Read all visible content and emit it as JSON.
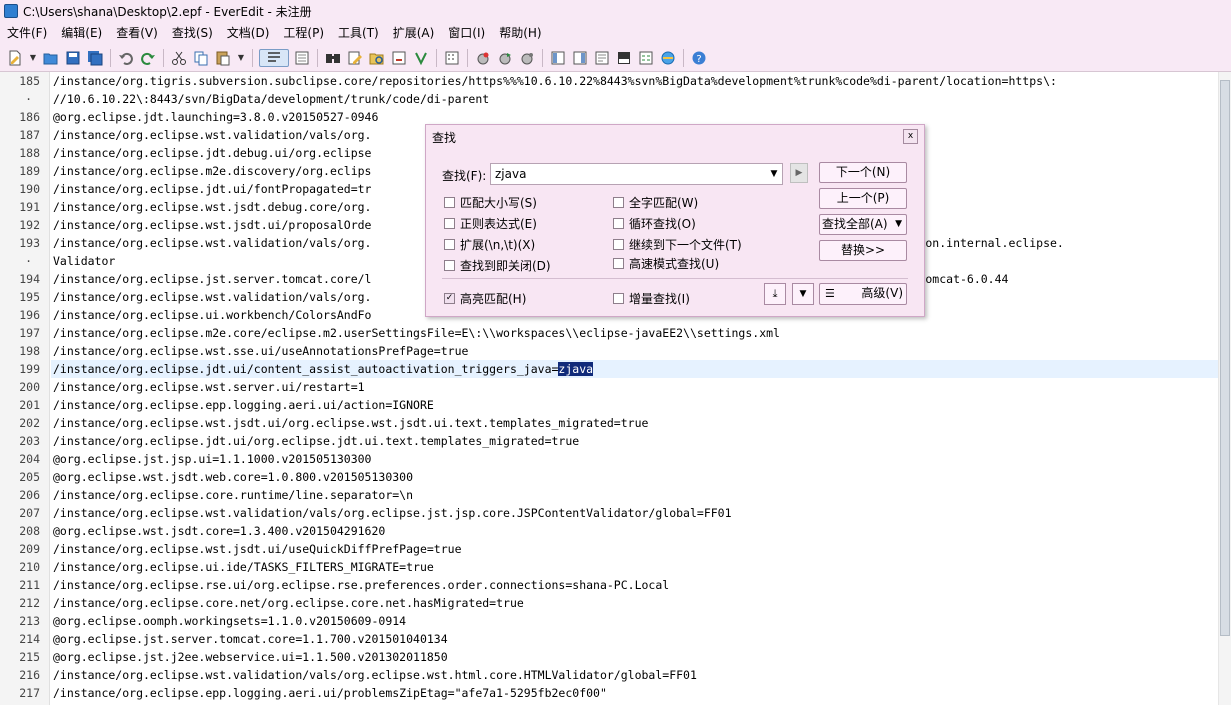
{
  "window": {
    "title": "C:\\Users\\shana\\Desktop\\2.epf - EverEdit - 未注册"
  },
  "menu": [
    "文件(F)",
    "编辑(E)",
    "查看(V)",
    "查找(S)",
    "文档(D)",
    "工程(P)",
    "工具(T)",
    "扩展(A)",
    "窗口(I)",
    "帮助(H)"
  ],
  "toolbar_icons": [
    "new-file-icon",
    "open-folder-icon",
    "save-icon",
    "save-all-icon",
    "undo-icon",
    "redo-icon",
    "cut-icon",
    "copy-icon",
    "paste-icon",
    "word-wrap-icon",
    "column-mode-icon",
    "find-icon",
    "replace-icon",
    "find-in-files-icon",
    "regex-icon",
    "mark-icon",
    "hex-icon",
    "macro-record-icon",
    "macro-play-icon",
    "macro-icon",
    "file-tree-icon",
    "outline-icon",
    "clipboard-icon",
    "output-icon",
    "preview-icon",
    "browser-icon",
    "help-icon"
  ],
  "editor": {
    "lines": [
      {
        "n": "185",
        "text": "/instance/org.tigris.subversion.subclipse.core/repositories/https%%%10.6.10.22%8443%svn%BigData%development%trunk%code%di-parent/location=https\\:"
      },
      {
        "n": "·",
        "text": "//10.6.10.22\\:8443/svn/BigData/development/trunk/code/di-parent"
      },
      {
        "n": "186",
        "text": "@org.eclipse.jdt.launching=3.8.0.v20150527-0946"
      },
      {
        "n": "187",
        "text": "/instance/org.eclipse.wst.validation/vals/org."
      },
      {
        "n": "188",
        "text": "/instance/org.eclipse.jdt.debug.ui/org.eclipse                                                                  es=true"
      },
      {
        "n": "189",
        "text": "/instance/org.eclipse.m2e.discovery/org.eclips"
      },
      {
        "n": "190",
        "text": "/instance/org.eclipse.jdt.ui/fontPropagated=tr"
      },
      {
        "n": "191",
        "text": "/instance/org.eclipse.wst.jsdt.debug.core/org."
      },
      {
        "n": "192",
        "text": "/instance/org.eclipse.wst.jsdt.ui/proposalOrde"
      },
      {
        "n": "193",
        "text": "/instance/org.eclipse.wst.validation/vals/org.                                                                   wsdl.validation.internal.eclipse."
      },
      {
        "n": "·",
        "text": "Validator"
      },
      {
        "n": "194",
        "text": "/instance/org.eclipse.jst.server.tomcat.core/l                                                                   m/GreenSoft/tomcat-6.0.44"
      },
      {
        "n": "195",
        "text": "/instance/org.eclipse.wst.validation/vals/org."
      },
      {
        "n": "196",
        "text": "/instance/org.eclipse.ui.workbench/ColorsAndFo"
      },
      {
        "n": "197",
        "text": "/instance/org.eclipse.m2e.core/eclipse.m2.userSettingsFile=E\\:\\\\workspaces\\\\eclipse-javaEE2\\\\settings.xml"
      },
      {
        "n": "198",
        "text": "/instance/org.eclipse.wst.sse.ui/useAnnotationsPrefPage=true"
      },
      {
        "n": "199",
        "text": "/instance/org.eclipse.jdt.ui/content_assist_autoactivation_triggers_java=",
        "sel": "zjava"
      },
      {
        "n": "200",
        "text": "/instance/org.eclipse.wst.server.ui/restart=1"
      },
      {
        "n": "201",
        "text": "/instance/org.eclipse.epp.logging.aeri.ui/action=IGNORE"
      },
      {
        "n": "202",
        "text": "/instance/org.eclipse.wst.jsdt.ui/org.eclipse.wst.jsdt.ui.text.templates_migrated=true"
      },
      {
        "n": "203",
        "text": "/instance/org.eclipse.jdt.ui/org.eclipse.jdt.ui.text.templates_migrated=true"
      },
      {
        "n": "204",
        "text": "@org.eclipse.jst.jsp.ui=1.1.1000.v201505130300"
      },
      {
        "n": "205",
        "text": "@org.eclipse.wst.jsdt.web.core=1.0.800.v201505130300"
      },
      {
        "n": "206",
        "text": "/instance/org.eclipse.core.runtime/line.separator=\\n"
      },
      {
        "n": "207",
        "text": "/instance/org.eclipse.wst.validation/vals/org.eclipse.jst.jsp.core.JSPContentValidator/global=FF01"
      },
      {
        "n": "208",
        "text": "@org.eclipse.wst.jsdt.core=1.3.400.v201504291620"
      },
      {
        "n": "209",
        "text": "/instance/org.eclipse.wst.jsdt.ui/useQuickDiffPrefPage=true"
      },
      {
        "n": "210",
        "text": "/instance/org.eclipse.ui.ide/TASKS_FILTERS_MIGRATE=true"
      },
      {
        "n": "211",
        "text": "/instance/org.eclipse.rse.ui/org.eclipse.rse.preferences.order.connections=shana-PC.Local"
      },
      {
        "n": "212",
        "text": "/instance/org.eclipse.core.net/org.eclipse.core.net.hasMigrated=true"
      },
      {
        "n": "213",
        "text": "@org.eclipse.oomph.workingsets=1.1.0.v20150609-0914"
      },
      {
        "n": "214",
        "text": "@org.eclipse.jst.server.tomcat.core=1.1.700.v201501040134"
      },
      {
        "n": "215",
        "text": "@org.eclipse.jst.j2ee.webservice.ui=1.1.500.v201302011850"
      },
      {
        "n": "216",
        "text": "/instance/org.eclipse.wst.validation/vals/org.eclipse.wst.html.core.HTMLValidator/global=FF01"
      },
      {
        "n": "217",
        "text": "/instance/org.eclipse.epp.logging.aeri.ui/problemsZipEtag=\"afe7a1-5295fb2ec0f00\""
      }
    ]
  },
  "find_dialog": {
    "title": "查找",
    "close": "x",
    "find_label": "查找(F):",
    "find_value": "zjava",
    "find_next": "下一个(N)",
    "find_prev": "上一个(P)",
    "find_all": "查找全部(A)",
    "replace": "替换>>",
    "advanced": "高级(V)",
    "options": {
      "match_case": "匹配大小写(S)",
      "whole_word": "全字匹配(W)",
      "regex": "正则表达式(E)",
      "loop": "循环查找(O)",
      "extended": "扩展(\\n,\\t)(X)",
      "continue_next": "继续到下一个文件(T)",
      "close_on_find": "查找到即关闭(D)",
      "fast_mode": "高速模式查找(U)",
      "highlight": "高亮匹配(H)",
      "incremental": "增量查找(I)"
    },
    "highlight_checked": true
  }
}
